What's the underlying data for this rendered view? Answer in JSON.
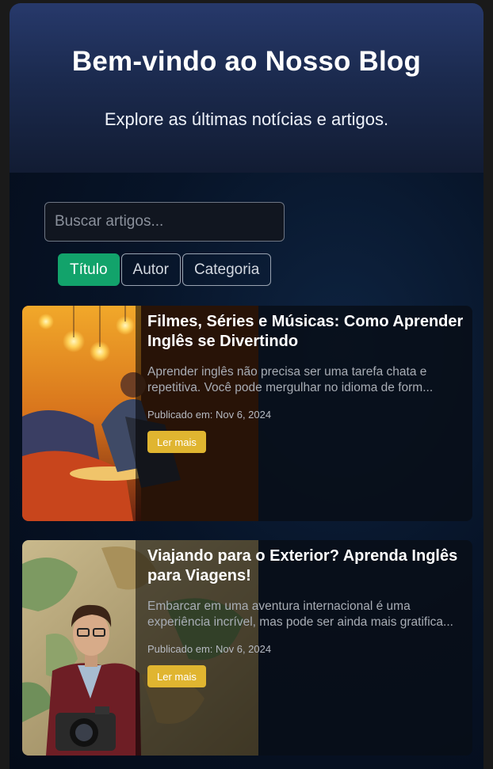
{
  "hero": {
    "title": "Bem-vindo ao Nosso Blog",
    "subtitle": "Explore as últimas notícias e artigos."
  },
  "search": {
    "placeholder": "Buscar artigos..."
  },
  "filters": [
    {
      "label": "Título",
      "active": true
    },
    {
      "label": "Autor",
      "active": false
    },
    {
      "label": "Categoria",
      "active": false
    }
  ],
  "articles": [
    {
      "title": "Filmes, Séries e Músicas: Como Aprender Inglês se Divertindo",
      "excerpt": "Aprender inglês não precisa ser uma tarefa chata e repetitiva. Você pode mergulhar no idioma de form...",
      "date": "Publicado em: Nov 6, 2024",
      "button": "Ler mais",
      "image": "people-relaxing-with-lights"
    },
    {
      "title": "Viajando para o Exterior? Aprenda Inglês para Viagens!",
      "excerpt": "Embarcar em uma aventura internacional é uma experiência incrível, mas pode ser ainda mais gratifica...",
      "date": "Publicado em: Nov 6, 2024",
      "button": "Ler mais",
      "image": "traveler-with-camera-and-map"
    }
  ],
  "colors": {
    "accent_green": "#12a36b",
    "button_yellow": "#e0b530",
    "hero_top": "#27396b"
  }
}
